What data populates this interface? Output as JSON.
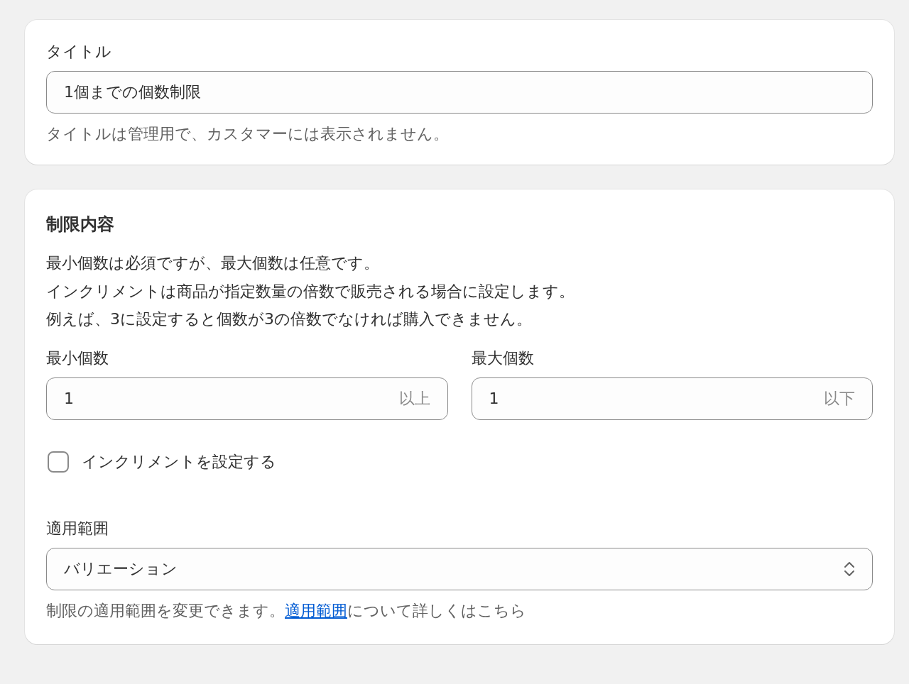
{
  "title_card": {
    "label": "タイトル",
    "value": "1個までの個数制限",
    "help": "タイトルは管理用で、カスタマーには表示されません。"
  },
  "limits_card": {
    "heading": "制限内容",
    "description": [
      "最小個数は必須ですが、最大個数は任意です。",
      "インクリメントは商品が指定数量の倍数で販売される場合に設定します。",
      "例えば、3に設定すると個数が3の倍数でなければ購入できません。"
    ],
    "fields": [
      {
        "label": "最小個数",
        "value": "1",
        "suffix": "以上"
      },
      {
        "label": "最大個数",
        "value": "1",
        "suffix": "以下"
      }
    ],
    "increment": {
      "label": "インクリメントを設定する",
      "checked": false
    },
    "scope": {
      "label": "適用範囲",
      "value": "バリエーション",
      "help_before": "制限の適用範囲を変更できます。",
      "help_link": "適用範囲",
      "help_after": "について詳しくはこちら"
    }
  }
}
